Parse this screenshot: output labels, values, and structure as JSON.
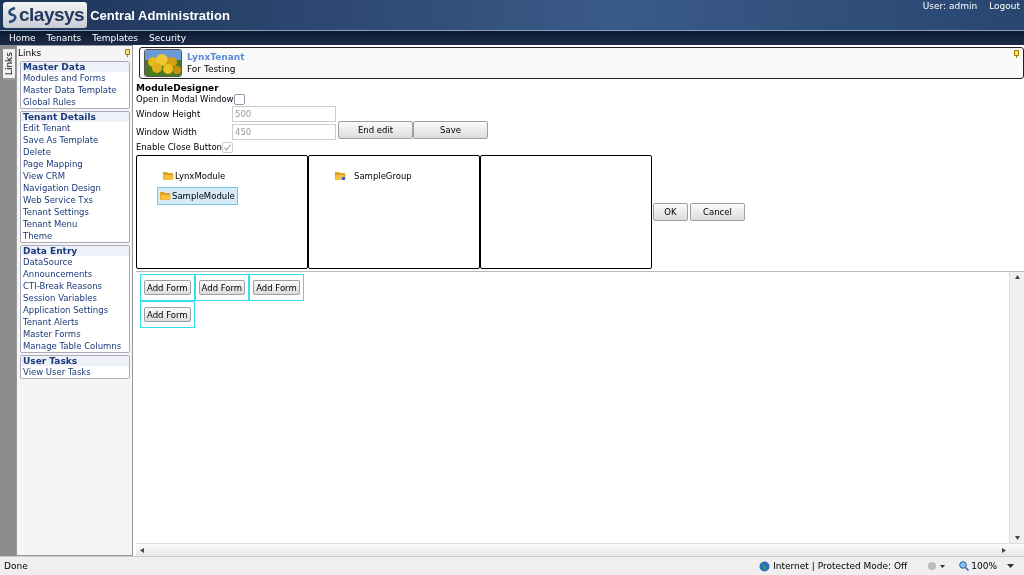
{
  "header": {
    "logo": "claysys",
    "title": "Central Administration",
    "user": "User: admin",
    "logout": "Logout"
  },
  "nav": [
    "Home",
    "Tenants",
    "Templates",
    "Security"
  ],
  "links_panel": {
    "tab": "Links",
    "title": "Links",
    "groups": [
      {
        "title": "Master Data",
        "items": [
          "Modules and Forms",
          "Master Data Template",
          "Global Rules"
        ]
      },
      {
        "title": "Tenant Details",
        "items": [
          "Edit Tenant",
          "Save As Template",
          "Delete",
          "Page Mapping",
          "View CRM",
          "Navigation Design",
          "Web Service Txs",
          "Tenant Settings",
          "Tenant Menu",
          "Theme"
        ]
      },
      {
        "title": "Data Entry",
        "items": [
          "DataSource",
          "Announcements",
          "CTI-Break Reasons",
          "Session Variables",
          "Application Settings",
          "Tenant Alerts",
          "Master Forms",
          "Manage Table Columns"
        ]
      },
      {
        "title": "User Tasks",
        "items": [
          "View User Tasks"
        ]
      }
    ]
  },
  "tenant": {
    "name": "LynxTenant",
    "description": "For Testing"
  },
  "designer": {
    "title": "ModuleDesigner",
    "open_modal": {
      "label": "Open in Modal Window",
      "checked": false
    },
    "window_height": {
      "label": "Window Height",
      "value": "500",
      "disabled": true
    },
    "window_width": {
      "label": "Window Width",
      "value": "450",
      "disabled": true
    },
    "enable_close": {
      "label": "Enable Close Button",
      "checked": true,
      "disabled": true
    },
    "buttons": [
      "End edit",
      "Save"
    ],
    "modules": [
      {
        "label": "LynxModule",
        "selected": false
      },
      {
        "label": "SampleModule",
        "selected": true
      }
    ],
    "groups": [
      {
        "label": "SampleGroup"
      }
    ],
    "dialog_buttons": [
      "OK",
      "Cancel"
    ]
  },
  "forms": [
    "Add Form",
    "Add Form",
    "Add Form",
    "Add Form"
  ],
  "status_bar": {
    "text": "Done",
    "zone": "Internet | Protected Mode: Off",
    "zoom": "100%"
  }
}
